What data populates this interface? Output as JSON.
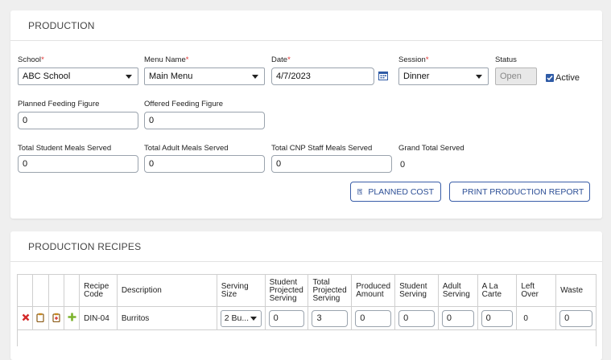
{
  "production": {
    "title": "PRODUCTION",
    "school": {
      "label": "School",
      "value": "ABC School"
    },
    "menu_name": {
      "label": "Menu Name",
      "value": "Main Menu"
    },
    "date": {
      "label": "Date",
      "value": "4/7/2023"
    },
    "session": {
      "label": "Session",
      "value": "Dinner"
    },
    "status": {
      "label": "Status",
      "value": "Open"
    },
    "active": {
      "label": "Active",
      "checked": true
    },
    "planned_feeding": {
      "label": "Planned Feeding Figure",
      "value": "0"
    },
    "offered_feeding": {
      "label": "Offered Feeding Figure",
      "value": "0"
    },
    "total_student": {
      "label": "Total Student Meals Served",
      "value": "0"
    },
    "total_adult": {
      "label": "Total Adult Meals Served",
      "value": "0"
    },
    "total_cnp": {
      "label": "Total CNP Staff Meals Served",
      "value": "0"
    },
    "grand_total": {
      "label": "Grand Total Served",
      "value": "0"
    },
    "planned_cost_button": "PLANNED COST",
    "print_button": "PRINT PRODUCTION REPORT",
    "required_mark": "*"
  },
  "recipes": {
    "title": "PRODUCTION RECIPES",
    "headers": {
      "recipe_code": [
        "Recipe",
        "Code"
      ],
      "description": "Description",
      "serving_size": [
        "Serving",
        "Size"
      ],
      "student_projected": [
        "Student",
        "Projected",
        "Serving"
      ],
      "total_projected": [
        "Total",
        "Projected",
        "Serving"
      ],
      "produced": [
        "Produced",
        "Amount"
      ],
      "student_serving": [
        "Student",
        "Serving"
      ],
      "adult_serving": [
        "Adult",
        "Serving"
      ],
      "a_la_carte": [
        "A La",
        "Carte"
      ],
      "left_over": [
        "Left",
        "Over"
      ],
      "waste": "Waste"
    },
    "rows": [
      {
        "recipe_code": "DIN-04",
        "description": "Burritos",
        "serving_size": "2 Bu...",
        "student_projected": "0",
        "total_projected": "3",
        "produced": "0",
        "student_serving": "0",
        "adult_serving": "0",
        "a_la_carte": "0",
        "left_over": "0",
        "waste": "0"
      }
    ]
  },
  "colors": {
    "accent": "#2f5ba6",
    "required": "#e03030",
    "delete_icon": "#d42a2a",
    "add_icon": "#7cb32d",
    "clipboard_icon": "#c8891f"
  },
  "icons": {
    "delete": "x-icon",
    "copy": "clipboard-icon",
    "paste": "clipboard-plus-icon",
    "add": "plus-icon",
    "calendar": "calendar-icon",
    "planned_cost": "calculator-icon",
    "print": "printer-icon"
  }
}
